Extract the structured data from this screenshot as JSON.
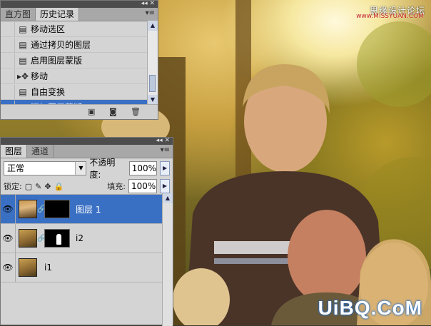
{
  "watermarks": {
    "top_text": "思缘设计论坛",
    "top_small": "www.MISSYUAN.COM",
    "bottom_text": "UiBQ.CoM"
  },
  "history_panel": {
    "tabs": [
      "直方图",
      "历史记录"
    ],
    "active_tab": 1,
    "items": [
      {
        "label": "移动选区",
        "icon": "document-icon"
      },
      {
        "label": "通过拷贝的图层",
        "icon": "document-icon"
      },
      {
        "label": "启用图层蒙版",
        "icon": "document-icon"
      },
      {
        "label": "移动",
        "icon": "move-icon"
      },
      {
        "label": "自由变换",
        "icon": "document-icon"
      },
      {
        "label": "添加图层蒙版",
        "icon": "document-icon",
        "selected": true
      }
    ]
  },
  "layers_panel": {
    "tabs": [
      "图层",
      "通道"
    ],
    "active_tab": 0,
    "blend_mode": "正常",
    "opacity_label": "不透明度:",
    "opacity_value": "100%",
    "lock_label": "锁定:",
    "fill_label": "填充:",
    "fill_value": "100%",
    "layers": [
      {
        "name": "图层 1",
        "selected": true,
        "has_mask": true
      },
      {
        "name": "i2",
        "selected": false,
        "has_mask": true
      },
      {
        "name": "i1",
        "selected": false,
        "has_mask": false
      }
    ]
  }
}
